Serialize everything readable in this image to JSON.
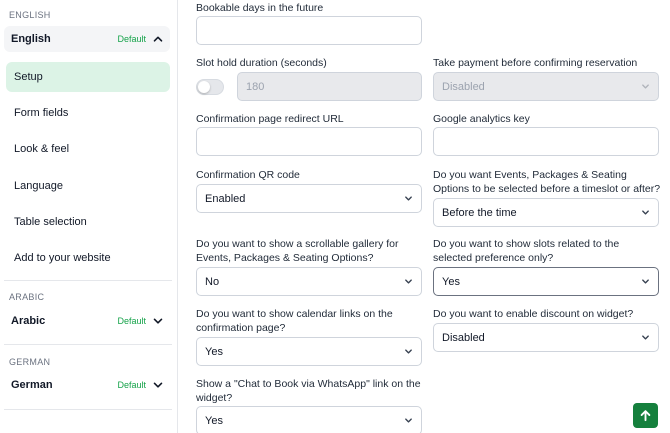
{
  "colors": {
    "accent": "#16a34a",
    "accent_bg": "#dcf3e6",
    "fab": "#15803d"
  },
  "sidebar": {
    "groups": [
      {
        "heading": "ENGLISH",
        "language": "English",
        "badge": "Default",
        "expanded": true,
        "chevron": "chevron-up-icon"
      },
      {
        "heading": "ARABIC",
        "language": "Arabic",
        "badge": "Default",
        "expanded": false,
        "chevron": "chevron-down-icon"
      },
      {
        "heading": "GERMAN",
        "language": "German",
        "badge": "Default",
        "expanded": false,
        "chevron": "chevron-down-icon"
      }
    ],
    "menu": [
      {
        "label": "Setup",
        "active": true
      },
      {
        "label": "Form fields",
        "active": false
      },
      {
        "label": "Look & feel",
        "active": false
      },
      {
        "label": "Language",
        "active": false
      },
      {
        "label": "Table selection",
        "active": false
      },
      {
        "label": "Add to your website",
        "active": false
      }
    ]
  },
  "form": {
    "bookable_days": {
      "label": "Bookable days in the future",
      "value": ""
    },
    "slot_hold": {
      "label": "Slot hold duration (seconds)",
      "value": "180",
      "toggle_on": false
    },
    "take_payment": {
      "label": "Take payment before confirming reservation",
      "value": "Disabled",
      "disabled": true
    },
    "redirect_url": {
      "label": "Confirmation page redirect URL",
      "value": ""
    },
    "analytics_key": {
      "label": "Google analytics key",
      "value": ""
    },
    "qr_code": {
      "label": "Confirmation QR code",
      "value": "Enabled"
    },
    "options_before": {
      "label_line1": "Do you want Events, Packages & Seating",
      "label_line2": "Options to be selected before a timeslot or after?",
      "value": "Before the time"
    },
    "scrollable_gallery": {
      "label_line1": "Do you want to show a scrollable gallery for",
      "label_line2": "Events, Packages & Seating Options?",
      "value": "No"
    },
    "related_slots": {
      "label_line1": "Do you want to show slots related to the",
      "label_line2": "selected preference only?",
      "value": "Yes"
    },
    "calendar_links": {
      "label_line1": "Do you want to show calendar links on the",
      "label_line2": "confirmation page?",
      "value": "Yes"
    },
    "discount": {
      "label": "Do you want to enable discount on widget?",
      "value": "Disabled"
    },
    "whatsapp": {
      "label_line1": "Show a \"Chat to Book via WhatsApp\" link on the",
      "label_line2": "widget?",
      "value": "Yes"
    }
  },
  "fab": {
    "icon": "arrow-up-icon"
  }
}
